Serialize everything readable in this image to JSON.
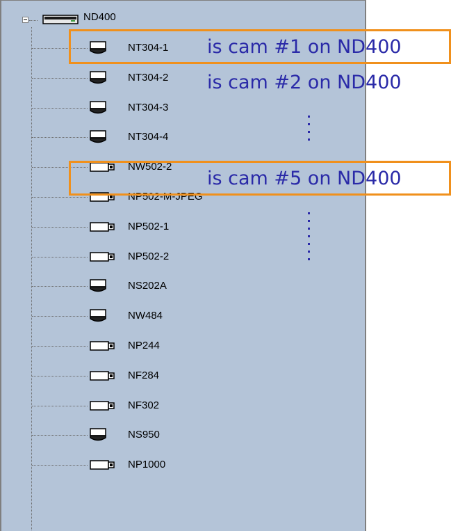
{
  "tree": {
    "root": {
      "label": "ND400",
      "icon": "nvr-device-icon",
      "expanded": true
    },
    "children": [
      {
        "label": "NT304-1",
        "icon": "dome-camera-icon"
      },
      {
        "label": "NT304-2",
        "icon": "dome-camera-icon"
      },
      {
        "label": "NT304-3",
        "icon": "dome-camera-icon"
      },
      {
        "label": "NT304-4",
        "icon": "dome-camera-icon"
      },
      {
        "label": "NW502-2",
        "icon": "box-camera-icon"
      },
      {
        "label": "NP502-M-JPEG",
        "icon": "box-camera-icon"
      },
      {
        "label": "NP502-1",
        "icon": "box-camera-icon"
      },
      {
        "label": "NP502-2",
        "icon": "box-camera-icon"
      },
      {
        "label": "NS202A",
        "icon": "dome-camera-icon"
      },
      {
        "label": "NW484",
        "icon": "dome-camera-icon"
      },
      {
        "label": "NP244",
        "icon": "box-camera-icon"
      },
      {
        "label": "NF284",
        "icon": "box-camera-icon"
      },
      {
        "label": "NF302",
        "icon": "box-camera-icon"
      },
      {
        "label": "NS950",
        "icon": "dome-camera-icon"
      },
      {
        "label": "NP1000",
        "icon": "box-camera-icon"
      }
    ]
  },
  "annotations": [
    {
      "text": "is cam #1 on ND400"
    },
    {
      "text": "is cam #2 on ND400"
    },
    {
      "text": "is cam #5 on ND400"
    }
  ],
  "colors": {
    "panel_background": "#b4c4d8",
    "annotation_box": "#f0901c",
    "annotation_text": "#2a2aa8"
  }
}
